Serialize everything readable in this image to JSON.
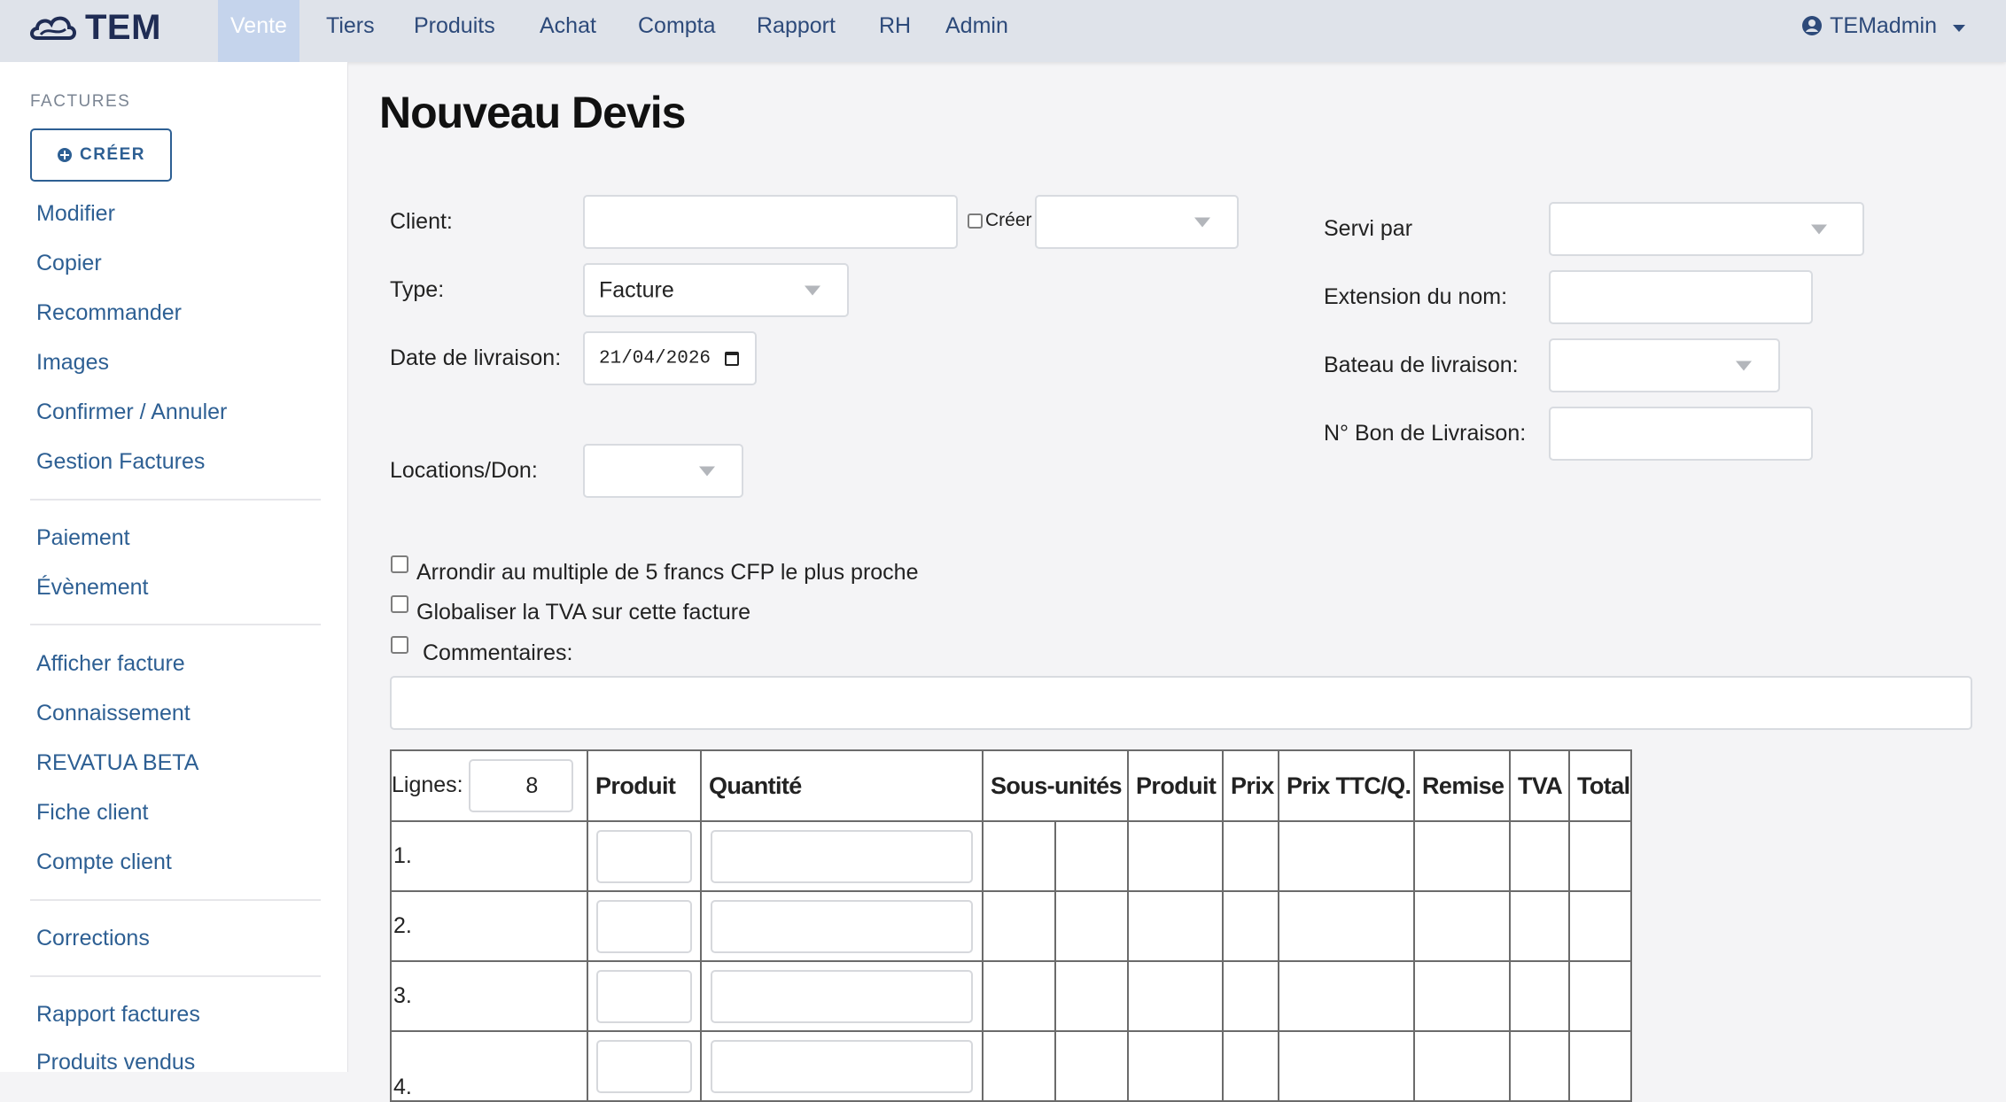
{
  "nav": {
    "logo_text": "TEM",
    "items": [
      {
        "label": "Vente",
        "active": true
      },
      {
        "label": "Tiers"
      },
      {
        "label": "Produits"
      },
      {
        "label": "Achat"
      },
      {
        "label": "Compta"
      },
      {
        "label": "Rapport"
      },
      {
        "label": "RH"
      },
      {
        "label": "Admin"
      }
    ],
    "user": "TEMadmin",
    "user_icon": "user-circle-icon"
  },
  "sidebar": {
    "section_title": "FACTURES",
    "create_label": "CRÉER",
    "create_icon": "plus-circle-icon",
    "groups": [
      [
        "Modifier",
        "Copier",
        "Recommander",
        "Images",
        "Confirmer / Annuler",
        "Gestion Factures"
      ],
      [
        "Paiement",
        "Évènement"
      ],
      [
        "Afficher facture",
        "Connaissement",
        "REVATUA BETA",
        "Fiche client",
        "Compte client"
      ],
      [
        "Corrections"
      ],
      [
        "Rapport factures",
        "Produits vendus"
      ]
    ]
  },
  "main": {
    "title": "Nouveau Devis",
    "client_label": "Client:",
    "client_value": "",
    "creer_label": "Créer",
    "creer_select_value": "",
    "type_label": "Type:",
    "type_value": "Facture",
    "date_label": "Date de livraison:",
    "date_value": "21/04/2026",
    "locations_label": "Locations/Don:",
    "locations_value": "",
    "servi_par_label": "Servi par",
    "servi_par_value": "",
    "extension_label": "Extension du nom:",
    "extension_value": "",
    "bateau_label": "Bateau de livraison:",
    "bateau_value": "",
    "bon_label": "N° Bon de Livraison:",
    "bon_value": "",
    "round_label": "Arrondir au multiple de 5 francs CFP le plus proche",
    "tva_label": "Globaliser la TVA sur cette facture",
    "comments_label": "Commentaires:",
    "comments_value": ""
  },
  "table": {
    "lines_label": "Lignes:",
    "lines_value": "8",
    "headers": [
      "Produit",
      "Quantité",
      "Sous-unités",
      "Produit",
      "Prix",
      "Prix TTC/Q.",
      "Remise",
      "TVA",
      "Total"
    ],
    "rows": [
      "1.",
      "2.",
      "3.",
      "4."
    ]
  }
}
